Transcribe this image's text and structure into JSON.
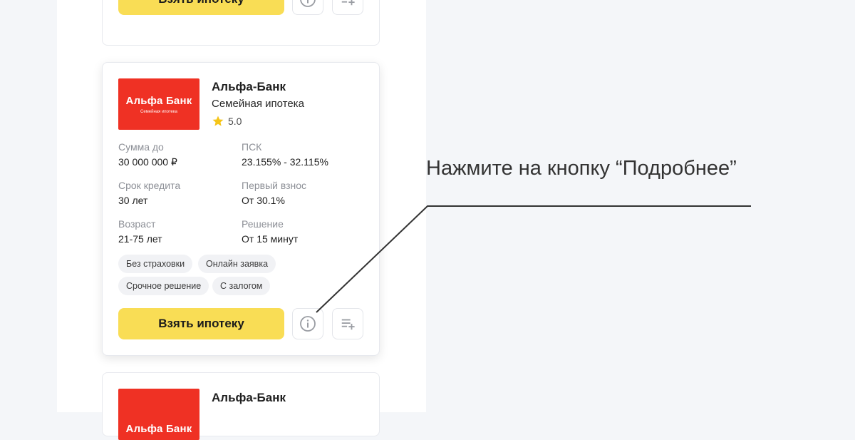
{
  "top_card": {
    "cta_label": "Взять ипотеку"
  },
  "offer": {
    "logo_brand": "Альфа Банк",
    "logo_subtitle": "Семейная ипотека",
    "bank_name": "Альфа-Банк",
    "product": "Семейная ипотека",
    "rating": "5.0",
    "params": [
      {
        "label": "Сумма до",
        "value": "30 000 000 ₽"
      },
      {
        "label": "ПСК",
        "value": "23.155% - 32.115%"
      },
      {
        "label": "Срок кредита",
        "value": "30 лет"
      },
      {
        "label": "Первый взнос",
        "value": "От 30.1%"
      },
      {
        "label": "Возраст",
        "value": "21-75 лет"
      },
      {
        "label": "Решение",
        "value": "От 15 минут"
      }
    ],
    "tags": [
      "Без страховки",
      "Онлайн заявка",
      "Срочное решение",
      "С залогом"
    ],
    "cta_label": "Взять ипотеку"
  },
  "bottom_card": {
    "logo_brand": "Альфа Банк",
    "bank_name": "Альфа-Банк"
  },
  "annotation": {
    "text": "Нажмите на кнопку “Подробнее”"
  },
  "colors": {
    "accent_yellow": "#f9dd55",
    "bank_red": "#ef3124",
    "star": "#f5c518"
  },
  "icons": {
    "info": "info-circle-icon",
    "compare": "playlist-add-icon",
    "star": "star-icon"
  }
}
